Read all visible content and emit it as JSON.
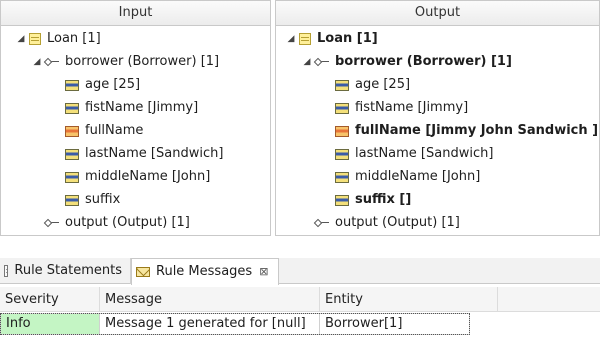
{
  "input_panel": {
    "title": "Input",
    "tree": [
      {
        "label": "Loan [1]",
        "icon": "class-icon",
        "twisty": "expanded",
        "bold": false
      },
      {
        "label": "borrower (Borrower) [1]",
        "icon": "association-icon",
        "twisty": "expanded",
        "bold": false
      },
      {
        "label": "age [25]",
        "icon": "attribute-icon",
        "bold": false
      },
      {
        "label": "fistName [Jimmy]",
        "icon": "attribute-icon",
        "bold": false
      },
      {
        "label": "fullName",
        "icon": "attribute-derived-icon",
        "bold": false
      },
      {
        "label": "lastName [Sandwich]",
        "icon": "attribute-icon",
        "bold": false
      },
      {
        "label": "middleName [John]",
        "icon": "attribute-icon",
        "bold": false
      },
      {
        "label": "suffix",
        "icon": "attribute-icon",
        "bold": false
      },
      {
        "label": "output (Output) [1]",
        "icon": "association-icon",
        "bold": false
      }
    ]
  },
  "output_panel": {
    "title": "Output",
    "tree": [
      {
        "label": "Loan [1]",
        "icon": "class-icon",
        "twisty": "expanded",
        "bold": true
      },
      {
        "label": "borrower (Borrower) [1]",
        "icon": "association-icon",
        "twisty": "expanded",
        "bold": true
      },
      {
        "label": "age [25]",
        "icon": "attribute-icon",
        "bold": false
      },
      {
        "label": "fistName [Jimmy]",
        "icon": "attribute-icon",
        "bold": false
      },
      {
        "label": "fullName [Jimmy John Sandwich ]",
        "icon": "attribute-derived-icon",
        "bold": true
      },
      {
        "label": "lastName [Sandwich]",
        "icon": "attribute-icon",
        "bold": false
      },
      {
        "label": "middleName [John]",
        "icon": "attribute-icon",
        "bold": false
      },
      {
        "label": "suffix []",
        "icon": "attribute-icon",
        "bold": true
      },
      {
        "label": "output (Output) [1]",
        "icon": "association-icon",
        "bold": false
      }
    ]
  },
  "tabs": [
    {
      "label": "Rule Statements",
      "icon": "rule-statements-icon",
      "active": false
    },
    {
      "label": "Rule Messages",
      "icon": "rule-messages-icon",
      "active": true,
      "close": "⊠"
    }
  ],
  "messages_table": {
    "columns": [
      "Severity",
      "Message",
      "Entity"
    ],
    "rows": [
      {
        "severity": "Info",
        "message": "Message 1 generated for [null]",
        "entity": "Borrower[1]"
      }
    ]
  },
  "colors": {
    "info_severity_bg": "#c4f5c4",
    "panel_border": "#c9c9c9"
  }
}
